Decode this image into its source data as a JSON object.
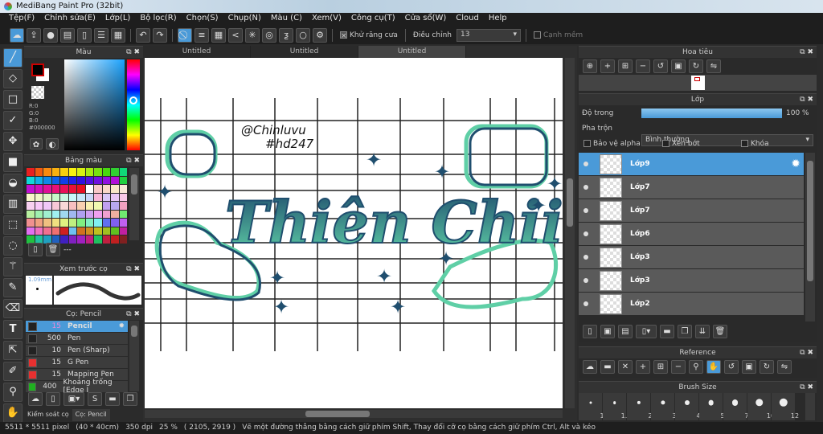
{
  "app": {
    "title": "MediBang Paint Pro (32bit)"
  },
  "menu": [
    "Tệp(F)",
    "Chỉnh sửa(E)",
    "Lớp(L)",
    "Bộ lọc(R)",
    "Chọn(S)",
    "Chụp(N)",
    "Màu (C)",
    "Xem(V)",
    "Công cụ(T)",
    "Cửa sổ(W)",
    "Cloud",
    "Help"
  ],
  "toolbar": {
    "antialias_label": "Khử răng cưa",
    "adjust_label": "Điều chỉnh",
    "adjust_value": "13",
    "soft_edge_label": "Cạnh mềm",
    "antialias_checked": true,
    "soft_edge_checked": false
  },
  "tabs": [
    "Untitled",
    "Untitled",
    "Untitled"
  ],
  "color_panel": {
    "title": "Màu",
    "r": "R:0",
    "g": "G:0",
    "b": "B:0",
    "hex": "#000000",
    "fg": "#000000",
    "bg": "#ffffff"
  },
  "palette_panel": {
    "title": "Bảng màu",
    "more": "---",
    "colors": [
      "#e82020",
      "#f05a10",
      "#f88a10",
      "#f8b010",
      "#f8d010",
      "#f8f010",
      "#d8f010",
      "#a8e810",
      "#78e010",
      "#48d810",
      "#30d030",
      "#10d878",
      "#10d8d8",
      "#10b0e8",
      "#1088e8",
      "#1060e8",
      "#1040e8",
      "#2020e8",
      "#3010e0",
      "#5010e0",
      "#7010e0",
      "#9010e0",
      "#b010d8",
      "#20d040",
      "#c010d0",
      "#d010b8",
      "#e01098",
      "#e81078",
      "#e81058",
      "#e81038",
      "#e81020",
      "#ffffff",
      "#f8c8c8",
      "#f8d8c8",
      "#f8e8c8",
      "#f8e8d8",
      "#f8f8c8",
      "#f0f8c8",
      "#e0f8c8",
      "#c8f8c8",
      "#c8f8e0",
      "#c8f8f8",
      "#c8e8f8",
      "#c8d8f8",
      "#f8b8d8",
      "#d8c8f8",
      "#e8c8f8",
      "#f8c8e8",
      "#f8d0f0",
      "#f8c8f8",
      "#f0c8f8",
      "#f8c8d8",
      "#f8d8d8",
      "#f8c0c0",
      "#f8d0b0",
      "#f8f0b0",
      "#f0f8b0",
      "#c0a0f0",
      "#b8a8f0",
      "#f0a0c0",
      "#b8f0a0",
      "#a0f0b0",
      "#a0f0d0",
      "#a0f0f0",
      "#a0d8f0",
      "#a0b8f0",
      "#b0a0f0",
      "#d0a0f0",
      "#f0a0f0",
      "#f0a0d0",
      "#f0b0a0",
      "#70e870",
      "#f09090",
      "#f0a080",
      "#f0c080",
      "#f0e080",
      "#e0f080",
      "#c0f080",
      "#80f080",
      "#80f0c0",
      "#80f0f0",
      "#6070f0",
      "#8060f0",
      "#c060f0",
      "#e070f0",
      "#f070c0",
      "#f07090",
      "#f07070",
      "#d02020",
      "#70c0f0",
      "#d07020",
      "#d09020",
      "#c0c020",
      "#a0c020",
      "#60c020",
      "#c020a0",
      "#20c040",
      "#20c0a0",
      "#20a0c0",
      "#2060c0",
      "#4020c0",
      "#8020c0",
      "#a020c0",
      "#c02080",
      "#20c060",
      "#c02040",
      "#c02020",
      "#802020"
    ]
  },
  "preview_panel": {
    "title": "Xem trước cọ",
    "size": "1.09mm"
  },
  "brush_panel": {
    "title": "Cọ: Pencil",
    "items": [
      {
        "size": "15",
        "name": "Pencil",
        "color": "#222222",
        "selected": true
      },
      {
        "size": "500",
        "name": "Pen",
        "color": "#222222"
      },
      {
        "size": "10",
        "name": "Pen (Sharp)",
        "color": "#222222"
      },
      {
        "size": "15",
        "name": "G Pen",
        "color": "#e83030"
      },
      {
        "size": "15",
        "name": "Mapping Pen",
        "color": "#e83030"
      },
      {
        "size": "400",
        "name": "Khoảng trống [Edge I",
        "color": "#20b020"
      }
    ]
  },
  "bottom_tabs": [
    "Kiểm soát cọ",
    "Cọ: Pencil"
  ],
  "canvas": {
    "signature": "@Chinluvu",
    "tag": "#hd247",
    "title_text": "Thiên Chii"
  },
  "navigator": {
    "title": "Hoa tiêu"
  },
  "layer_panel": {
    "title": "Lớp",
    "opacity_label": "Độ trong",
    "opacity_value": "100 %",
    "opacity": 100,
    "blend_label": "Pha trộn",
    "blend_value": "Bình thường",
    "protect_alpha": "Bảo vệ alpha",
    "clipping": "Xén bớt",
    "lock": "Khóa",
    "layers": [
      {
        "name": "Lớp9",
        "selected": true
      },
      {
        "name": "Lớp7"
      },
      {
        "name": "Lớp7"
      },
      {
        "name": "Lớp6"
      },
      {
        "name": "Lớp3"
      },
      {
        "name": "Lớp3"
      },
      {
        "name": "Lớp2"
      }
    ]
  },
  "reference": {
    "title": "Reference"
  },
  "brush_size": {
    "title": "Brush Size",
    "sizes": [
      "1",
      "1.5",
      "2",
      "3",
      "4",
      "5",
      "7",
      "10",
      "12"
    ]
  },
  "status": {
    "size": "5511 * 5511 pixel",
    "cm": "(40 * 40cm)",
    "dpi": "350 dpi",
    "zoom": "25 %",
    "coords": "( 2105, 2919 )",
    "hint": "Vẽ một đường thẳng bằng cách giữ phím Shift, Thay đổi cỡ cọ bằng cách giữ phím Ctrl, Alt và kéo"
  },
  "accent": "#4a9ad8"
}
